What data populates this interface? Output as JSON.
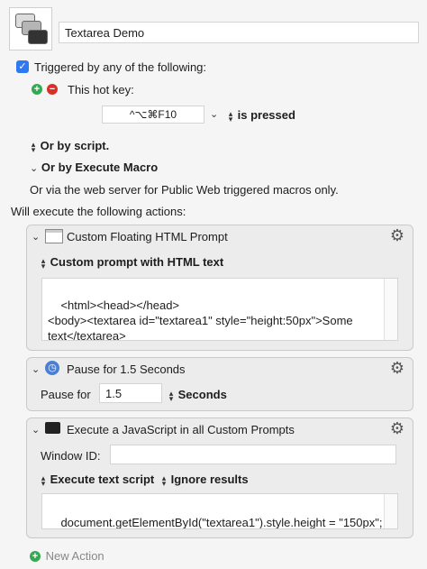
{
  "macro": {
    "name": "Textarea Demo"
  },
  "trigger": {
    "triggered_label": "Triggered by any of the following:",
    "hotkey_label": "This hot key:",
    "hotkey_value": "^⌥⌘F10",
    "hotkey_state": "is pressed",
    "or_by_script": "Or by script.",
    "or_by_execute_macro": "Or by Execute Macro",
    "web_server_note": "Or via the web server for Public Web triggered macros only."
  },
  "actions_header": "Will execute the following actions:",
  "actions": [
    {
      "title": "Custom Floating HTML Prompt",
      "mode": "Custom prompt with HTML text",
      "text": "<html><head></head>\n<body><textarea id=\"textarea1\" style=\"height:50px\">Some text</textarea>\n</body></html>"
    },
    {
      "title": "Pause for 1.5 Seconds",
      "pause_label": "Pause for",
      "pause_value": "1.5",
      "unit": "Seconds"
    },
    {
      "title": "Execute a JavaScript in all Custom Prompts",
      "window_id_label": "Window ID:",
      "window_id_value": "",
      "mode": "Execute text script",
      "results": "Ignore results",
      "script": "document.getElementById(\"textarea1\").style.height = \"150px\";"
    }
  ],
  "new_action_label": "New Action",
  "colors": {
    "accent": "#2f79f0",
    "add_green": "#34a853",
    "remove_red": "#d93025"
  }
}
